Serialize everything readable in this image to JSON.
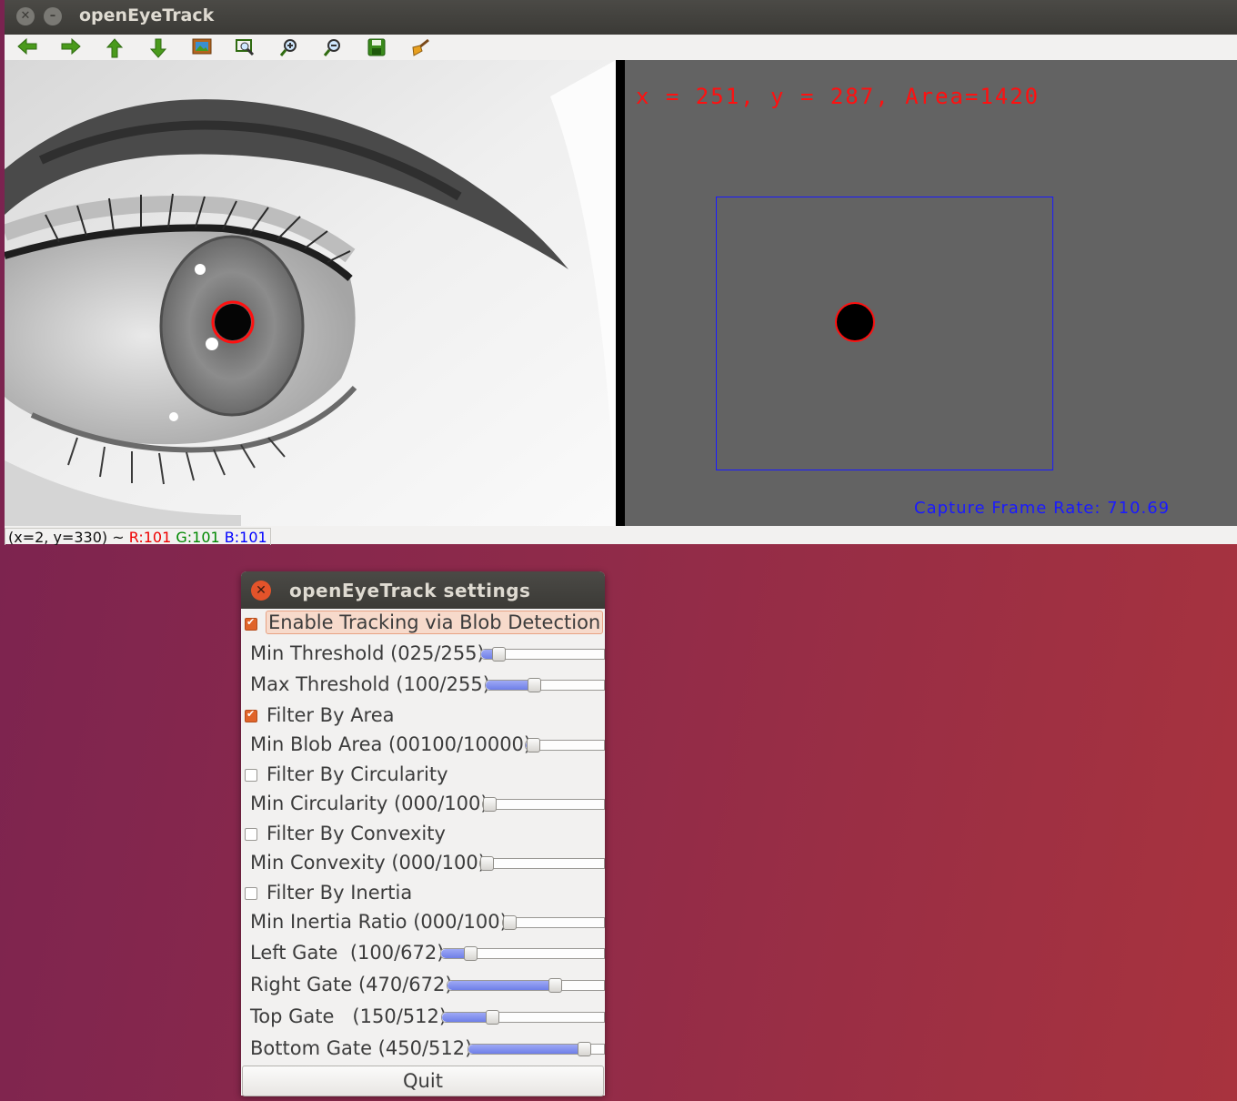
{
  "main_window": {
    "title": "openEyeTrack",
    "toolbar_icons": [
      "arrow-left-icon",
      "arrow-right-icon",
      "arrow-up-icon",
      "arrow-down-icon",
      "image-icon",
      "zoom-fit-icon",
      "zoom-in-icon",
      "zoom-out-icon",
      "save-icon",
      "clear-brush-icon"
    ],
    "overlay_coords": "x = 251, y = 287, Area=1420",
    "frame_rate": "Capture Frame Rate: 710.69",
    "status": {
      "pos": "(x=2, y=330) ~ ",
      "r": "R:101",
      "g": "G:101",
      "b": "B:101"
    }
  },
  "settings": {
    "title": "openEyeTrack settings",
    "enable_tracking": {
      "label": "Enable Tracking via Blob Detection",
      "checked": true
    },
    "min_threshold": {
      "label": "Min Threshold (025/255)",
      "value": 25,
      "max": 255
    },
    "max_threshold": {
      "label": "Max Threshold (100/255)",
      "value": 100,
      "max": 255
    },
    "filter_area": {
      "label": "Filter By Area",
      "checked": true
    },
    "min_blob_area": {
      "label": "Min Blob Area (00100/10000)",
      "value": 100,
      "max": 10000
    },
    "filter_circularity": {
      "label": "Filter By Circularity",
      "checked": false
    },
    "min_circularity": {
      "label": "Min Circularity (000/100)",
      "value": 0,
      "max": 100
    },
    "filter_convexity": {
      "label": "Filter By Convexity",
      "checked": false
    },
    "min_convexity": {
      "label": "Min Convexity (000/100)",
      "value": 0,
      "max": 100
    },
    "filter_inertia": {
      "label": "Filter By Inertia",
      "checked": false
    },
    "min_inertia": {
      "label": "Min Inertia Ratio (000/100)",
      "value": 0,
      "max": 100
    },
    "left_gate": {
      "label": "Left Gate  (100/672)",
      "value": 100,
      "max": 672
    },
    "right_gate": {
      "label": "Right Gate (470/672)",
      "value": 470,
      "max": 672
    },
    "top_gate": {
      "label": "Top Gate   (150/512)",
      "value": 150,
      "max": 512
    },
    "bottom_gate": {
      "label": "Bottom Gate (450/512)",
      "value": 450,
      "max": 512
    },
    "quit_label": "Quit"
  }
}
